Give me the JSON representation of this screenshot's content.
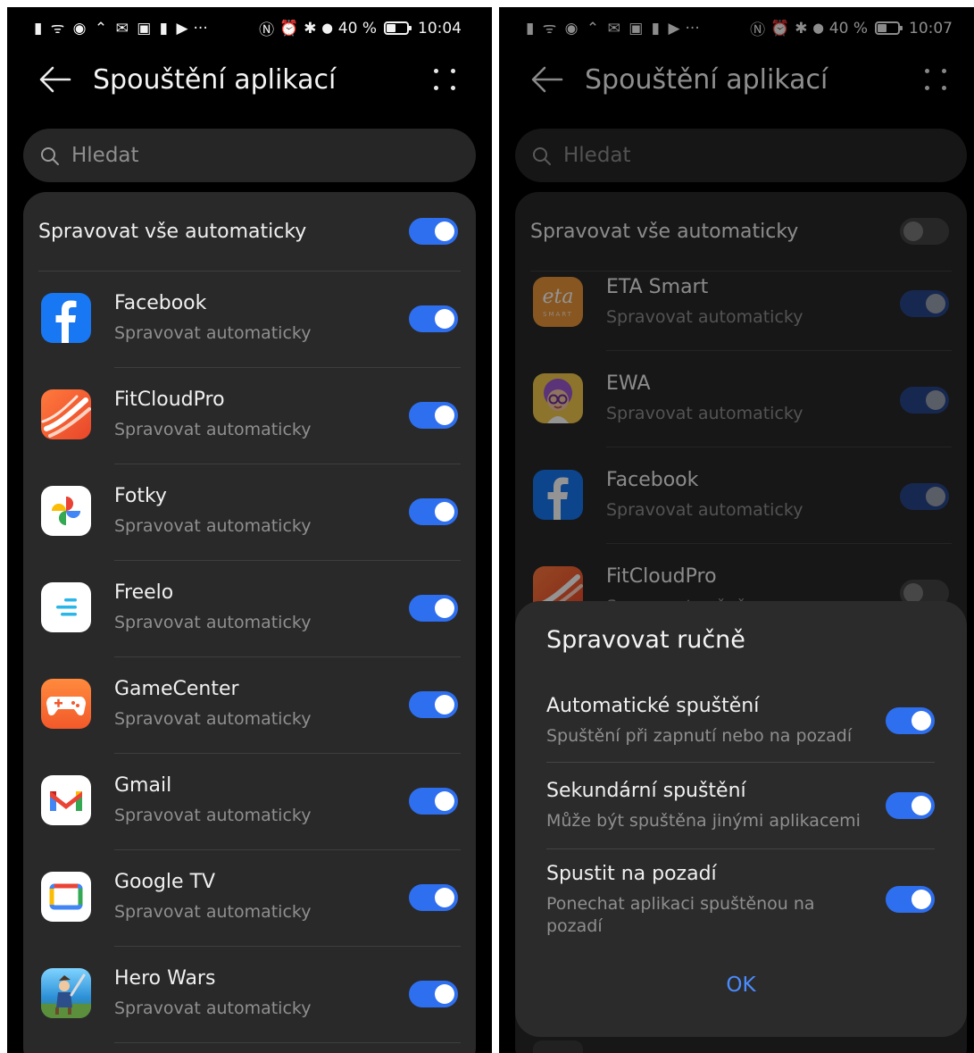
{
  "colors": {
    "accent": "#2e6ff0",
    "background": "#000000",
    "card": "#292929",
    "ok_text": "#4a8cff"
  },
  "screen_left": {
    "status": {
      "left_icons": "▮ ᯤ ◉ ⌃ ✉ ▣ ▮ ▶",
      "left_more": "···",
      "nfc": "Ⓝ",
      "alarm": "⏰",
      "bluetooth": "✱",
      "location": "⬤",
      "battery": "40 %",
      "time": "10:04"
    },
    "title": "Spouštění aplikací",
    "search_placeholder": "Hledat",
    "manage_all_label": "Spravovat vše automaticky",
    "manage_all_on": true,
    "apps": [
      {
        "name": "Facebook",
        "status": "Spravovat automaticky",
        "icon": "facebook-icon",
        "on": true
      },
      {
        "name": "FitCloudPro",
        "status": "Spravovat automaticky",
        "icon": "fitcloudpro-icon",
        "on": true
      },
      {
        "name": "Fotky",
        "status": "Spravovat automaticky",
        "icon": "google-photos-icon",
        "on": true
      },
      {
        "name": "Freelo",
        "status": "Spravovat automaticky",
        "icon": "freelo-icon",
        "on": true
      },
      {
        "name": "GameCenter",
        "status": "Spravovat automaticky",
        "icon": "gamecenter-icon",
        "on": true
      },
      {
        "name": "Gmail",
        "status": "Spravovat automaticky",
        "icon": "gmail-icon",
        "on": true
      },
      {
        "name": "Google TV",
        "status": "Spravovat automaticky",
        "icon": "google-tv-icon",
        "on": true
      },
      {
        "name": "Hero Wars",
        "status": "Spravovat automaticky",
        "icon": "hero-wars-icon",
        "on": true
      }
    ]
  },
  "screen_right": {
    "status": {
      "left_icons": "▮ ᯤ ◉ ⌃ ✉ ▣ ▮ ▶",
      "left_more": "···",
      "nfc": "Ⓝ",
      "alarm": "⏰",
      "bluetooth": "✱",
      "location": "⬤",
      "battery": "40 %",
      "time": "10:07"
    },
    "title": "Spouštění aplikací",
    "search_placeholder": "Hledat",
    "manage_all_label": "Spravovat vše automaticky",
    "manage_all_on": false,
    "apps": [
      {
        "name": "ETA Smart",
        "status": "Spravovat automaticky",
        "icon": "eta-smart-icon",
        "on": true,
        "logo_text": "eta",
        "logo_sub": "SMART"
      },
      {
        "name": "EWA",
        "status": "Spravovat automaticky",
        "icon": "ewa-icon",
        "on": true
      },
      {
        "name": "Facebook",
        "status": "Spravovat automaticky",
        "icon": "facebook-icon",
        "on": true
      },
      {
        "name": "FitCloudPro",
        "status": "Spravovat ručně",
        "icon": "fitcloudpro-icon",
        "on": false
      }
    ],
    "dialog": {
      "title": "Spravovat ručně",
      "options": [
        {
          "title": "Automatické spuštění",
          "subtitle": "Spuštění při zapnutí nebo na pozadí",
          "on": true
        },
        {
          "title": "Sekundární spuštění",
          "subtitle": "Může být spuštěna jinými aplikacemi",
          "on": true
        },
        {
          "title": "Spustit na pozadí",
          "subtitle": "Ponechat aplikaci spuštěnou na pozadí",
          "on": true
        }
      ],
      "ok_label": "OK"
    }
  }
}
